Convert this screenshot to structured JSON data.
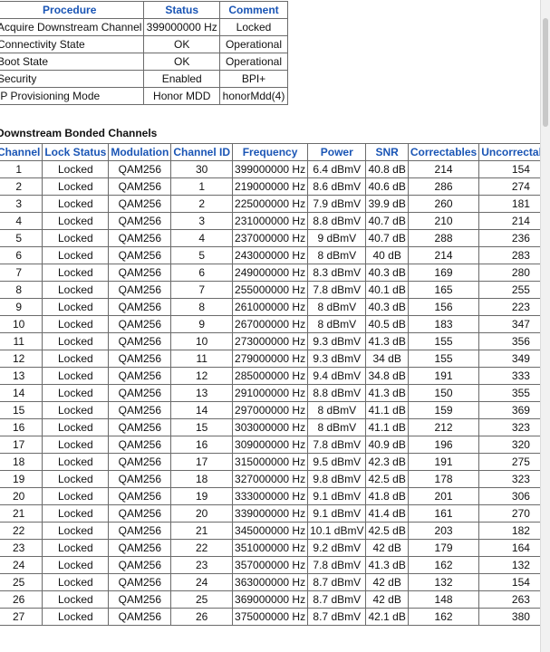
{
  "startup": {
    "headers": [
      "Procedure",
      "Status",
      "Comment"
    ],
    "rows": [
      [
        "Acquire Downstream Channel",
        "399000000 Hz",
        "Locked"
      ],
      [
        "Connectivity State",
        "OK",
        "Operational"
      ],
      [
        "Boot State",
        "OK",
        "Operational"
      ],
      [
        "Security",
        "Enabled",
        "BPI+"
      ],
      [
        "IP Provisioning Mode",
        "Honor MDD",
        "honorMdd(4)"
      ]
    ]
  },
  "downstream": {
    "title": "Downstream Bonded Channels",
    "headers": [
      "Channel",
      "Lock Status",
      "Modulation",
      "Channel ID",
      "Frequency",
      "Power",
      "SNR",
      "Correctables",
      "Uncorrectables"
    ],
    "rows": [
      [
        "1",
        "Locked",
        "QAM256",
        "30",
        "399000000 Hz",
        "6.4 dBmV",
        "40.8 dB",
        "214",
        "154"
      ],
      [
        "2",
        "Locked",
        "QAM256",
        "1",
        "219000000 Hz",
        "8.6 dBmV",
        "40.6 dB",
        "286",
        "274"
      ],
      [
        "3",
        "Locked",
        "QAM256",
        "2",
        "225000000 Hz",
        "7.9 dBmV",
        "39.9 dB",
        "260",
        "181"
      ],
      [
        "4",
        "Locked",
        "QAM256",
        "3",
        "231000000 Hz",
        "8.8 dBmV",
        "40.7 dB",
        "210",
        "214"
      ],
      [
        "5",
        "Locked",
        "QAM256",
        "4",
        "237000000 Hz",
        "9 dBmV",
        "40.7 dB",
        "288",
        "236"
      ],
      [
        "6",
        "Locked",
        "QAM256",
        "5",
        "243000000 Hz",
        "8 dBmV",
        "40 dB",
        "214",
        "283"
      ],
      [
        "7",
        "Locked",
        "QAM256",
        "6",
        "249000000 Hz",
        "8.3 dBmV",
        "40.3 dB",
        "169",
        "280"
      ],
      [
        "8",
        "Locked",
        "QAM256",
        "7",
        "255000000 Hz",
        "7.8 dBmV",
        "40.1 dB",
        "165",
        "255"
      ],
      [
        "9",
        "Locked",
        "QAM256",
        "8",
        "261000000 Hz",
        "8 dBmV",
        "40.3 dB",
        "156",
        "223"
      ],
      [
        "10",
        "Locked",
        "QAM256",
        "9",
        "267000000 Hz",
        "8 dBmV",
        "40.5 dB",
        "183",
        "347"
      ],
      [
        "11",
        "Locked",
        "QAM256",
        "10",
        "273000000 Hz",
        "9.3 dBmV",
        "41.3 dB",
        "155",
        "356"
      ],
      [
        "12",
        "Locked",
        "QAM256",
        "11",
        "279000000 Hz",
        "9.3 dBmV",
        "34 dB",
        "155",
        "349"
      ],
      [
        "13",
        "Locked",
        "QAM256",
        "12",
        "285000000 Hz",
        "9.4 dBmV",
        "34.8 dB",
        "191",
        "333"
      ],
      [
        "14",
        "Locked",
        "QAM256",
        "13",
        "291000000 Hz",
        "8.8 dBmV",
        "41.3 dB",
        "150",
        "355"
      ],
      [
        "15",
        "Locked",
        "QAM256",
        "14",
        "297000000 Hz",
        "8 dBmV",
        "41.1 dB",
        "159",
        "369"
      ],
      [
        "16",
        "Locked",
        "QAM256",
        "15",
        "303000000 Hz",
        "8 dBmV",
        "41.1 dB",
        "212",
        "323"
      ],
      [
        "17",
        "Locked",
        "QAM256",
        "16",
        "309000000 Hz",
        "7.8 dBmV",
        "40.9 dB",
        "196",
        "320"
      ],
      [
        "18",
        "Locked",
        "QAM256",
        "17",
        "315000000 Hz",
        "9.5 dBmV",
        "42.3 dB",
        "191",
        "275"
      ],
      [
        "19",
        "Locked",
        "QAM256",
        "18",
        "327000000 Hz",
        "9.8 dBmV",
        "42.5 dB",
        "178",
        "323"
      ],
      [
        "20",
        "Locked",
        "QAM256",
        "19",
        "333000000 Hz",
        "9.1 dBmV",
        "41.8 dB",
        "201",
        "306"
      ],
      [
        "21",
        "Locked",
        "QAM256",
        "20",
        "339000000 Hz",
        "9.1 dBmV",
        "41.4 dB",
        "161",
        "270"
      ],
      [
        "22",
        "Locked",
        "QAM256",
        "21",
        "345000000 Hz",
        "10.1 dBmV",
        "42.5 dB",
        "203",
        "182"
      ],
      [
        "23",
        "Locked",
        "QAM256",
        "22",
        "351000000 Hz",
        "9.2 dBmV",
        "42 dB",
        "179",
        "164"
      ],
      [
        "24",
        "Locked",
        "QAM256",
        "23",
        "357000000 Hz",
        "7.8 dBmV",
        "41.3 dB",
        "162",
        "132"
      ],
      [
        "25",
        "Locked",
        "QAM256",
        "24",
        "363000000 Hz",
        "8.7 dBmV",
        "42 dB",
        "132",
        "154"
      ],
      [
        "26",
        "Locked",
        "QAM256",
        "25",
        "369000000 Hz",
        "8.7 dBmV",
        "42 dB",
        "148",
        "263"
      ],
      [
        "27",
        "Locked",
        "QAM256",
        "26",
        "375000000 Hz",
        "8.7 dBmV",
        "42.1 dB",
        "162",
        "380"
      ]
    ]
  }
}
